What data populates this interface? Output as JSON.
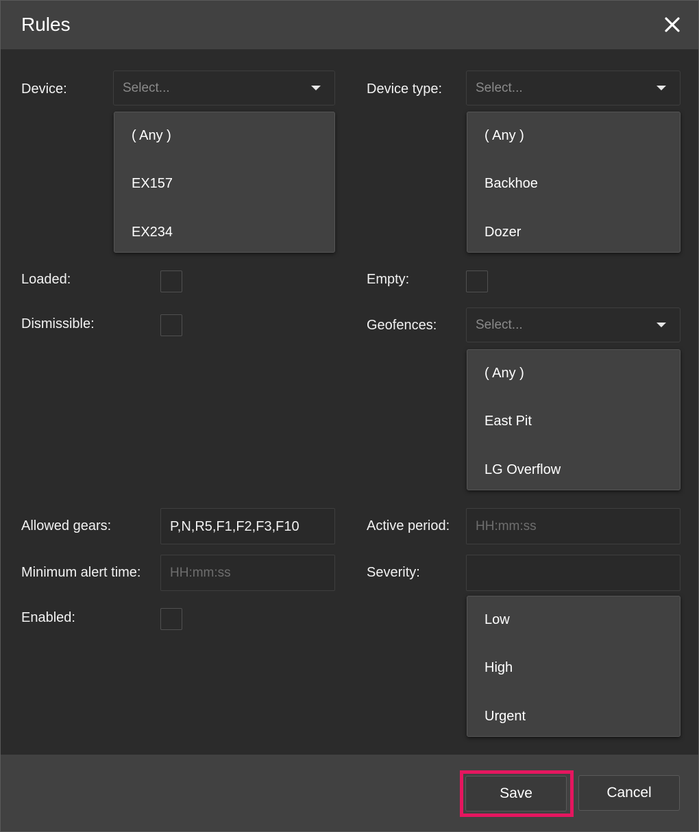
{
  "dialog": {
    "title": "Rules",
    "close_icon": "close-icon"
  },
  "device": {
    "label": "Device:",
    "placeholder": "Select...",
    "options": [
      "( Any )",
      "EX157",
      "EX234"
    ]
  },
  "device_type": {
    "label": "Device type:",
    "placeholder": "Select...",
    "options": [
      "( Any )",
      "Backhoe",
      "Dozer"
    ]
  },
  "loaded": {
    "label": "Loaded:",
    "checked": false
  },
  "empty": {
    "label": "Empty:",
    "checked": false
  },
  "dismissible": {
    "label": "Dismissible:",
    "checked": false
  },
  "geofences": {
    "label": "Geofences:",
    "placeholder": "Select...",
    "options": [
      "( Any )",
      "East Pit",
      "LG Overflow"
    ]
  },
  "allowed_gears": {
    "label": "Allowed gears:",
    "value": "P,N,R5,F1,F2,F3,F10"
  },
  "active_period": {
    "label": "Active period:",
    "placeholder": "HH:mm:ss"
  },
  "minimum_alert_time": {
    "label": "Minimum alert time:",
    "placeholder": "HH:mm:ss"
  },
  "severity": {
    "label": "Severity:",
    "value": "",
    "options": [
      "Low",
      "High",
      "Urgent"
    ]
  },
  "enabled": {
    "label": "Enabled:",
    "checked": false
  },
  "footer": {
    "save_label": "Save",
    "cancel_label": "Cancel"
  },
  "colors": {
    "dialog_bg": "#2b2b2b",
    "header_bg": "#414141",
    "dropdown_bg": "#414141",
    "highlight": "#e5165f"
  }
}
